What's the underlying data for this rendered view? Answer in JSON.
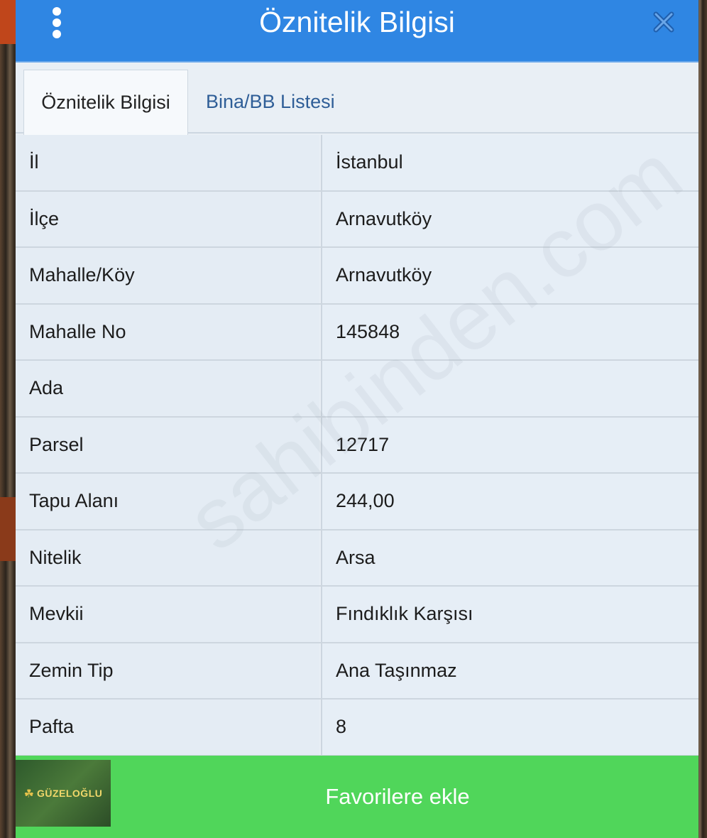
{
  "header": {
    "title": "Öznitelik Bilgisi",
    "menu_icon": "kebab-menu-icon",
    "close_icon": "close-icon"
  },
  "tabs": [
    {
      "label": "Öznitelik Bilgisi",
      "active": true
    },
    {
      "label": "Bina/BB Listesi",
      "active": false
    }
  ],
  "attributes": [
    {
      "label": "İl",
      "value": "İstanbul"
    },
    {
      "label": "İlçe",
      "value": "Arnavutköy"
    },
    {
      "label": "Mahalle/Köy",
      "value": "Arnavutköy"
    },
    {
      "label": "Mahalle No",
      "value": "145848"
    },
    {
      "label": "Ada",
      "value": ""
    },
    {
      "label": "Parsel",
      "value": "12717"
    },
    {
      "label": "Tapu Alanı",
      "value": "244,00"
    },
    {
      "label": "Nitelik",
      "value": "Arsa"
    },
    {
      "label": "Mevkii",
      "value": "Fındıklık Karşısı"
    },
    {
      "label": "Zemin Tip",
      "value": "Ana Taşınmaz"
    },
    {
      "label": "Pafta",
      "value": "8"
    }
  ],
  "footer": {
    "favorite_label": "Favorilere ekle",
    "logo_text": "GÜZELOĞLU"
  },
  "watermark": "sahibinden.com",
  "colors": {
    "header": "#2f86e3",
    "footer": "#50d65a",
    "tab_inactive_text": "#2f5e97"
  }
}
